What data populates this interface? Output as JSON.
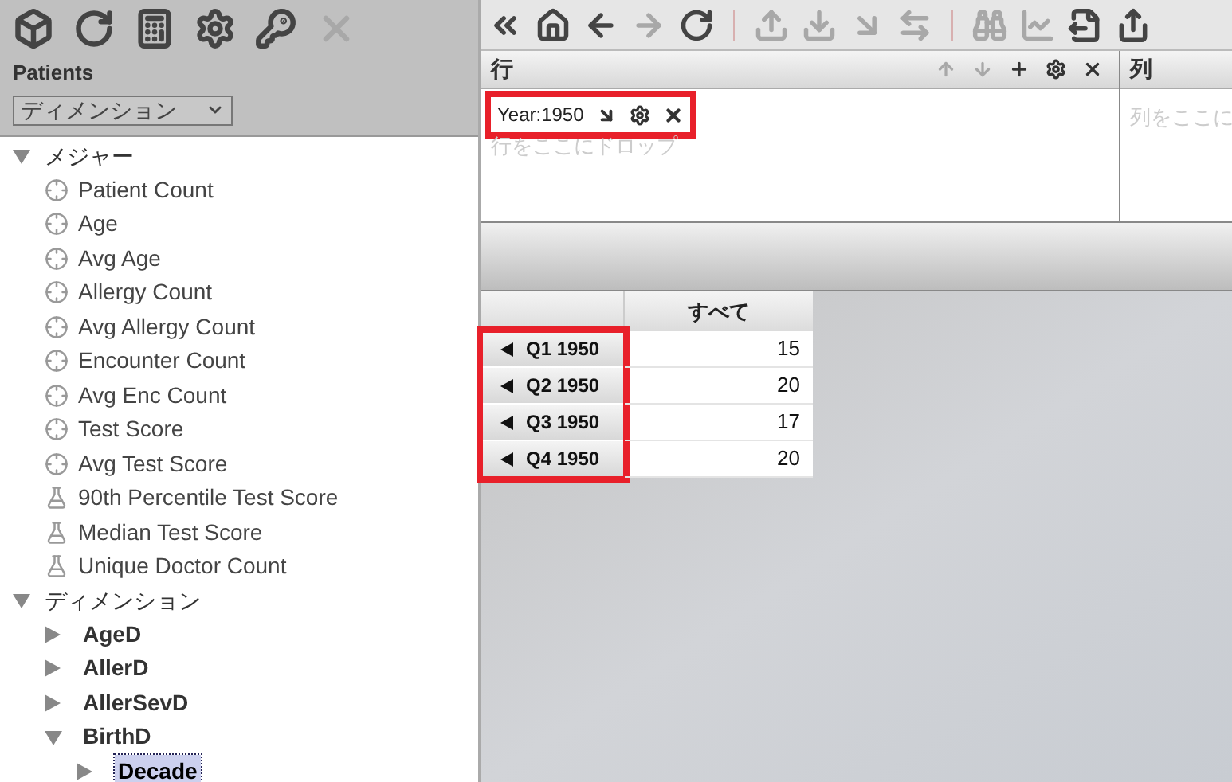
{
  "left_toolbar": [
    {
      "kind": "cube",
      "disabled": false
    },
    {
      "kind": "refresh",
      "disabled": false
    },
    {
      "kind": "calculator",
      "disabled": false
    },
    {
      "kind": "settings",
      "disabled": false
    },
    {
      "kind": "keyhole",
      "disabled": false
    },
    {
      "kind": "close",
      "disabled": true
    }
  ],
  "cube_title": "Patients",
  "view_select": {
    "value": "ディメンション"
  },
  "tree": [
    {
      "label": "メジャー",
      "expanded": true,
      "children": [
        {
          "label": "Patient Count",
          "kind": "measure"
        },
        {
          "label": "Age",
          "kind": "measure"
        },
        {
          "label": "Avg Age",
          "kind": "measure"
        },
        {
          "label": "Allergy Count",
          "kind": "measure"
        },
        {
          "label": "Avg Allergy Count",
          "kind": "measure"
        },
        {
          "label": "Encounter Count",
          "kind": "measure"
        },
        {
          "label": "Avg Enc Count",
          "kind": "measure"
        },
        {
          "label": "Test Score",
          "kind": "measure"
        },
        {
          "label": "Avg Test Score",
          "kind": "measure"
        },
        {
          "label": "90th Percentile Test Score",
          "kind": "calculated"
        },
        {
          "label": "Median Test Score",
          "kind": "calculated"
        },
        {
          "label": "Unique Doctor Count",
          "kind": "calculated"
        }
      ]
    },
    {
      "label": "ディメンション",
      "expanded": true,
      "children": [
        {
          "label": "AgeD",
          "kind": "dimension",
          "expanded": false,
          "selected": false
        },
        {
          "label": "AllerD",
          "kind": "dimension",
          "expanded": false,
          "selected": false
        },
        {
          "label": "AllerSevD",
          "kind": "dimension",
          "expanded": false,
          "selected": false
        },
        {
          "label": "BirthD",
          "kind": "dimension",
          "expanded": true,
          "selected": false,
          "children": [
            {
              "label": "Decade",
              "kind": "dimension",
              "expanded": false,
              "selected": true
            }
          ]
        }
      ]
    }
  ],
  "main_toolbar": [
    {
      "kind": "collapse",
      "disabled": false
    },
    {
      "kind": "home",
      "disabled": false
    },
    {
      "kind": "back",
      "disabled": false
    },
    {
      "kind": "forward",
      "disabled": true
    },
    {
      "kind": "refresh",
      "disabled": false
    },
    {
      "kind": "separator"
    },
    {
      "kind": "upload",
      "disabled": true
    },
    {
      "kind": "download",
      "disabled": true
    },
    {
      "kind": "drill",
      "disabled": true
    },
    {
      "kind": "swap",
      "disabled": true
    },
    {
      "kind": "separator"
    },
    {
      "kind": "binoculars",
      "disabled": true
    },
    {
      "kind": "line-chart",
      "disabled": true
    },
    {
      "kind": "export",
      "disabled": false
    },
    {
      "kind": "share",
      "disabled": false
    }
  ],
  "rows_panel": {
    "title": "行",
    "tools": [
      {
        "kind": "up",
        "disabled": true
      },
      {
        "kind": "down",
        "disabled": true
      },
      {
        "kind": "add",
        "disabled": false
      },
      {
        "kind": "settings",
        "disabled": false
      },
      {
        "kind": "close",
        "disabled": false
      }
    ],
    "chip": {
      "label": "Year:1950",
      "highlighted": true
    },
    "placeholder": "行をここにドロップ"
  },
  "columns_panel": {
    "title": "列",
    "placeholder": "列をここに"
  },
  "pivot": {
    "column_header": "すべて",
    "rows_highlighted": true,
    "rows": [
      {
        "label": "Q1 1950",
        "value": "15"
      },
      {
        "label": "Q2 1950",
        "value": "20"
      },
      {
        "label": "Q3 1950",
        "value": "17"
      },
      {
        "label": "Q4 1950",
        "value": "20"
      }
    ]
  }
}
